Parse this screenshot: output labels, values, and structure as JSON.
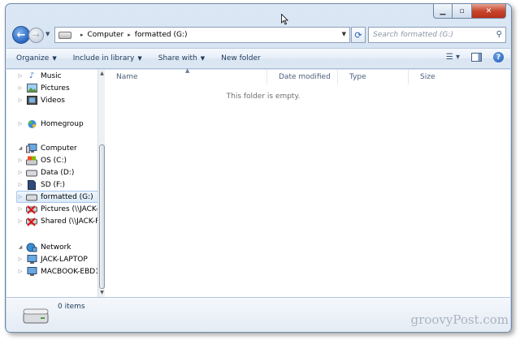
{
  "window": {
    "caption_buttons": {
      "minimize": "▁",
      "maximize": "▫",
      "close": "✕"
    }
  },
  "address_bar": {
    "segments": [
      "Computer",
      "formatted (G:)"
    ],
    "separator": "▸"
  },
  "search": {
    "placeholder": "Search formatted (G:)"
  },
  "toolbar": {
    "organize": "Organize",
    "include_in_library": "Include in library",
    "share_with": "Share with",
    "new_folder": "New folder"
  },
  "nav_tree": {
    "libraries": [
      "Music",
      "Pictures",
      "Videos"
    ],
    "homegroup": "Homegroup",
    "computer": "Computer",
    "drives": [
      "OS (C:)",
      "Data (D:)",
      "SD (F:)",
      "formatted (G:)",
      "Pictures (\\\\JACK-",
      "Shared (\\\\JACK-F"
    ],
    "network": "Network",
    "network_items": [
      "JACK-LAPTOP",
      "MACBOOK-EBD1"
    ]
  },
  "columns": [
    "Name",
    "Date modified",
    "Type",
    "Size"
  ],
  "empty_message": "This folder is empty.",
  "details": {
    "item_count": "0 items"
  },
  "watermark": "groovyPost.com",
  "colors": {
    "accent": "#1e395b",
    "selection": "#dbe9f9",
    "close_red": "#c7462d"
  }
}
